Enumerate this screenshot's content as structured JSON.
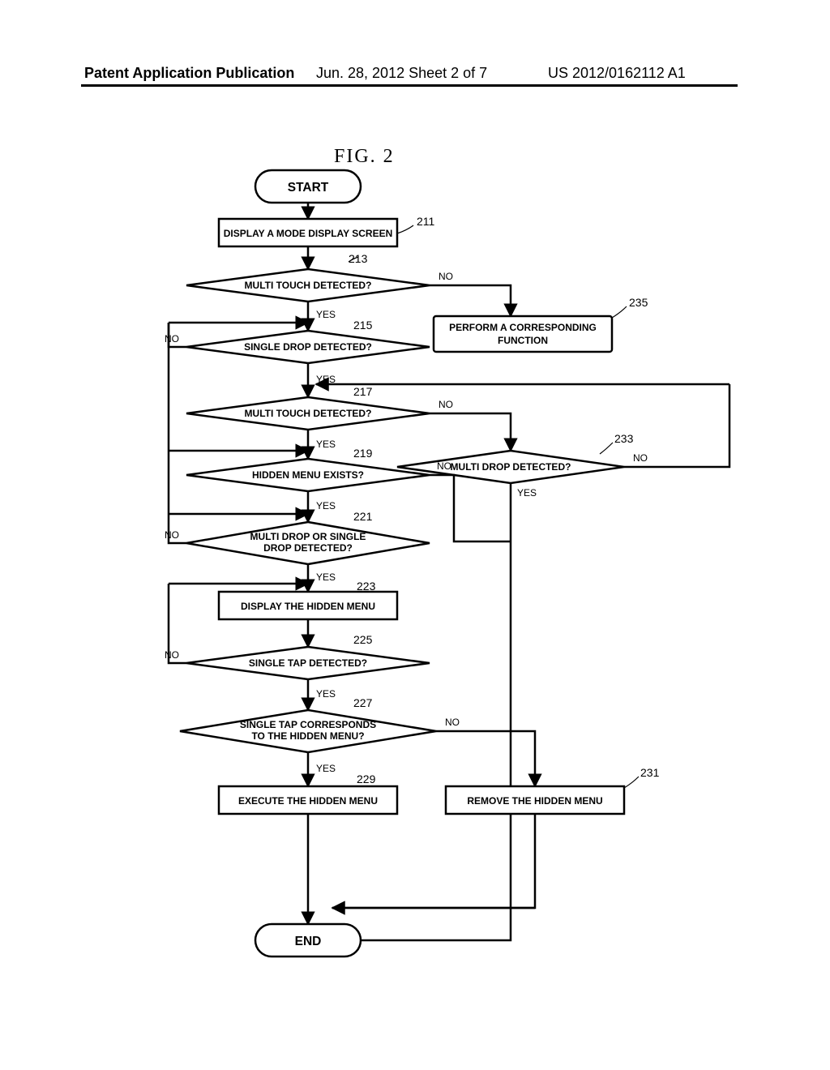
{
  "header": {
    "left": "Patent Application Publication",
    "mid": "Jun. 28, 2012  Sheet 2 of 7",
    "right": "US 2012/0162112 A1"
  },
  "figure": {
    "title": "FIG. 2"
  },
  "nodes": {
    "start": "START",
    "s211": "DISPLAY A MODE DISPLAY SCREEN",
    "d213": "MULTI TOUCH DETECTED?",
    "s235a": "PERFORM A CORRESPONDING",
    "s235b": "FUNCTION",
    "d215": "SINGLE DROP DETECTED?",
    "d217": "MULTI TOUCH DETECTED?",
    "d233": "MULTI DROP DETECTED?",
    "d219": "HIDDEN MENU EXISTS?",
    "d221a": "MULTI DROP OR SINGLE",
    "d221b": "DROP DETECTED?",
    "s223": "DISPLAY THE HIDDEN MENU",
    "d225": "SINGLE TAP DETECTED?",
    "d227a": "SINGLE TAP CORRESPONDS",
    "d227b": "TO THE HIDDEN MENU?",
    "s229": "EXECUTE THE HIDDEN MENU",
    "s231": "REMOVE THE HIDDEN MENU",
    "end": "END"
  },
  "refs": {
    "r211": "211",
    "r213": "213",
    "r215": "215",
    "r217": "217",
    "r219": "219",
    "r221": "221",
    "r223": "223",
    "r225": "225",
    "r227": "227",
    "r229": "229",
    "r231": "231",
    "r233": "233",
    "r235": "235"
  },
  "labels": {
    "yes": "YES",
    "no": "NO"
  },
  "chart_data": {
    "type": "flowchart",
    "title": "FIG. 2",
    "nodes": [
      {
        "id": "start",
        "kind": "terminator",
        "text": "START"
      },
      {
        "id": "211",
        "kind": "process",
        "text": "DISPLAY A MODE DISPLAY SCREEN"
      },
      {
        "id": "213",
        "kind": "decision",
        "text": "MULTI TOUCH DETECTED?"
      },
      {
        "id": "235",
        "kind": "process",
        "text": "PERFORM A CORRESPONDING FUNCTION"
      },
      {
        "id": "215",
        "kind": "decision",
        "text": "SINGLE DROP DETECTED?"
      },
      {
        "id": "217",
        "kind": "decision",
        "text": "MULTI TOUCH DETECTED?"
      },
      {
        "id": "233",
        "kind": "decision",
        "text": "MULTI DROP DETECTED?"
      },
      {
        "id": "219",
        "kind": "decision",
        "text": "HIDDEN MENU EXISTS?"
      },
      {
        "id": "221",
        "kind": "decision",
        "text": "MULTI DROP OR SINGLE DROP DETECTED?"
      },
      {
        "id": "223",
        "kind": "process",
        "text": "DISPLAY THE HIDDEN MENU"
      },
      {
        "id": "225",
        "kind": "decision",
        "text": "SINGLE TAP DETECTED?"
      },
      {
        "id": "227",
        "kind": "decision",
        "text": "SINGLE TAP CORRESPONDS TO THE HIDDEN MENU?"
      },
      {
        "id": "229",
        "kind": "process",
        "text": "EXECUTE THE HIDDEN MENU"
      },
      {
        "id": "231",
        "kind": "process",
        "text": "REMOVE THE HIDDEN MENU"
      },
      {
        "id": "end",
        "kind": "terminator",
        "text": "END"
      }
    ],
    "edges": [
      {
        "from": "start",
        "to": "211"
      },
      {
        "from": "211",
        "to": "213"
      },
      {
        "from": "213",
        "to": "235",
        "label": "NO"
      },
      {
        "from": "213",
        "to": "215",
        "label": "YES"
      },
      {
        "from": "215",
        "to": "213",
        "label": "NO"
      },
      {
        "from": "215",
        "to": "217",
        "label": "YES"
      },
      {
        "from": "217",
        "to": "233",
        "label": "NO"
      },
      {
        "from": "217",
        "to": "219",
        "label": "YES"
      },
      {
        "from": "233",
        "to": "217",
        "label": "NO"
      },
      {
        "from": "233",
        "to": "end",
        "label": "YES"
      },
      {
        "from": "219",
        "to": "217",
        "label": "NO"
      },
      {
        "from": "219",
        "to": "221",
        "label": "YES"
      },
      {
        "from": "221",
        "to": "219",
        "label": "NO"
      },
      {
        "from": "221",
        "to": "223",
        "label": "YES"
      },
      {
        "from": "223",
        "to": "225"
      },
      {
        "from": "225",
        "to": "223",
        "label": "NO"
      },
      {
        "from": "225",
        "to": "227",
        "label": "YES"
      },
      {
        "from": "227",
        "to": "231",
        "label": "NO"
      },
      {
        "from": "227",
        "to": "229",
        "label": "YES"
      },
      {
        "from": "229",
        "to": "end"
      },
      {
        "from": "231",
        "to": "end"
      }
    ]
  }
}
